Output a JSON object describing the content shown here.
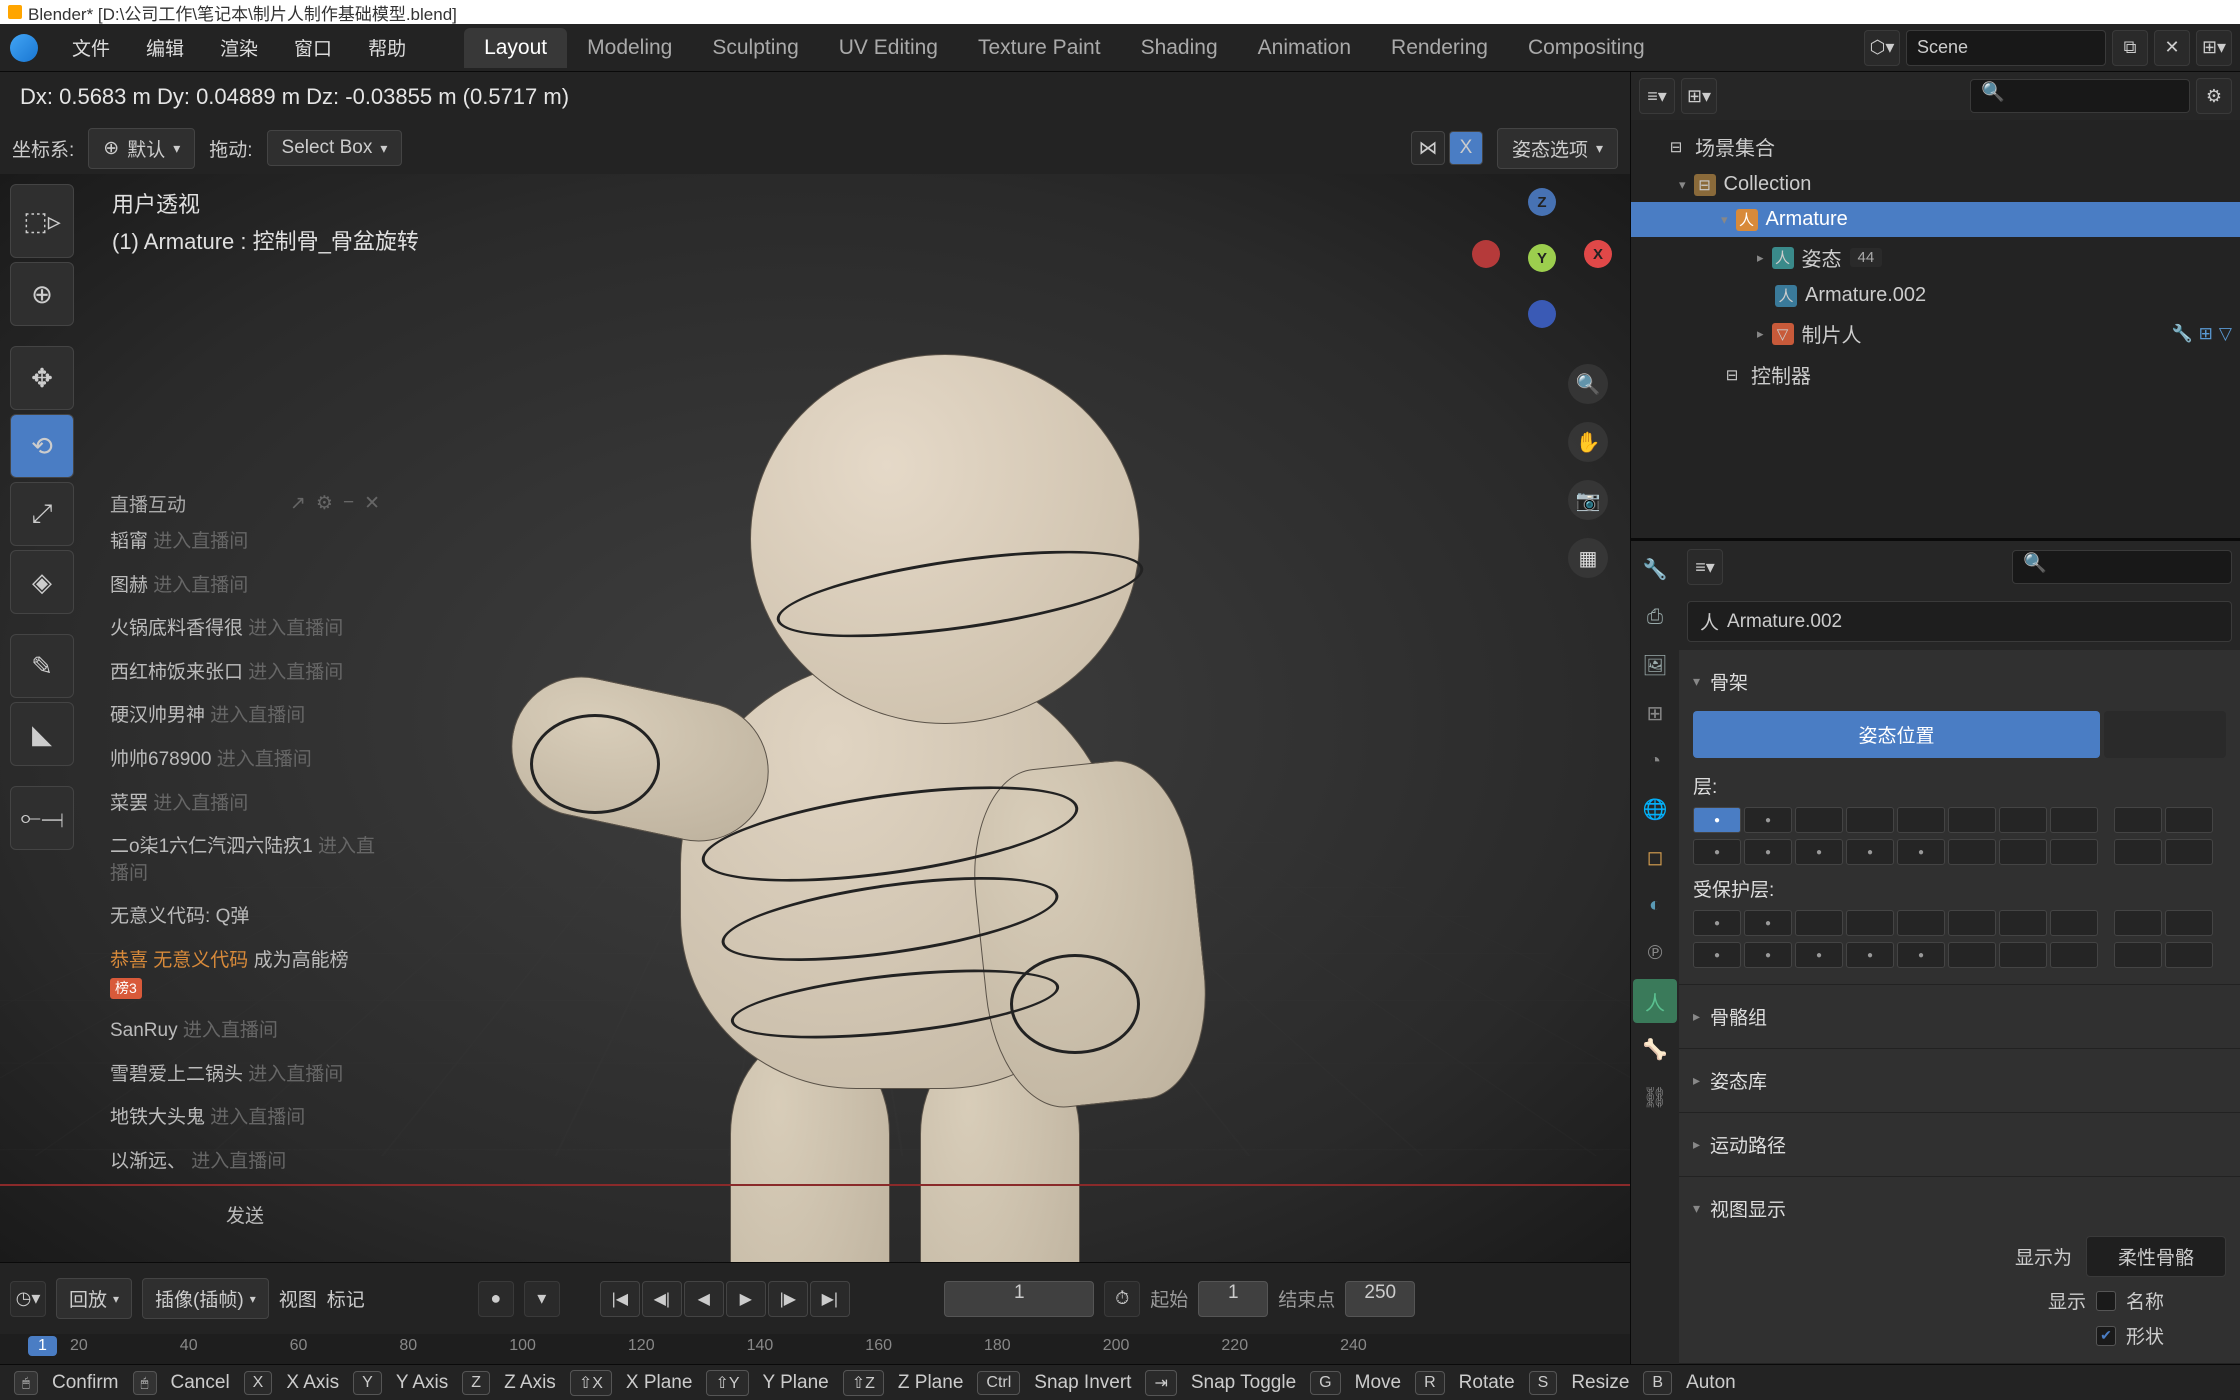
{
  "window_title": "Blender* [D:\\公司工作\\笔记本\\制片人制作基础模型.blend]",
  "menu": {
    "file": "文件",
    "edit": "编辑",
    "render": "渲染",
    "window": "窗口",
    "help": "帮助"
  },
  "workspaces": {
    "layout": "Layout",
    "modeling": "Modeling",
    "sculpting": "Sculpting",
    "uv": "UV Editing",
    "texture": "Texture Paint",
    "shading": "Shading",
    "animation": "Animation",
    "rendering": "Rendering",
    "compositing": "Compositing"
  },
  "topbar": {
    "scene": "Scene"
  },
  "transform_status": "Dx: 0.5683 m   Dy: 0.04889 m   Dz: -0.03855 m (0.5717 m)",
  "viewport_header": {
    "coord_label": "坐标系:",
    "coord_value": "默认",
    "drag_label": "拖动:",
    "select_mode": "Select Box",
    "pose_options": "姿态选项"
  },
  "viewport_overlay": {
    "view": "用户透视",
    "selection": "(1) Armature : 控制骨_骨盆旋转"
  },
  "gizmo": {
    "x": "X",
    "y": "Y",
    "z": "Z"
  },
  "chat": {
    "title": "直播互动",
    "send": "发送",
    "lines": [
      {
        "user": "韬甯",
        "action": "进入直播间"
      },
      {
        "user": "图赫",
        "action": "进入直播间"
      },
      {
        "user": "火锅底料香得很",
        "action": "进入直播间"
      },
      {
        "user": "西红柿饭来张口",
        "action": "进入直播间"
      },
      {
        "user": "硬汉帅男神",
        "action": "进入直播间"
      },
      {
        "user": "帅帅678900",
        "action": "进入直播间"
      },
      {
        "user": "菜罢",
        "action": "进入直播间"
      },
      {
        "user": "二o柒1六仁汽泗六陆疚1",
        "action": "进入直播间"
      },
      {
        "user": "无意义代码:",
        "action": "Q弹"
      },
      {
        "user": "恭喜 无意义代码",
        "action": "成为高能榜",
        "badge": "榜3"
      },
      {
        "user": "SanRuy",
        "action": "进入直播间"
      },
      {
        "user": "雪碧爱上二锅头",
        "action": "进入直播间"
      },
      {
        "user": "地铁大头鬼",
        "action": "进入直播间"
      },
      {
        "user": "以渐远、",
        "action": "进入直播间"
      }
    ]
  },
  "timeline": {
    "playback_label": "回放",
    "keying_label": "插像(插帧)",
    "view_label": "视图",
    "marker_label": "标记",
    "current_frame": "1",
    "start_label": "起始",
    "start_value": "1",
    "end_label": "结束点",
    "end_value": "250",
    "ticks": [
      "20",
      "40",
      "60",
      "80",
      "100",
      "120",
      "140",
      "160",
      "180",
      "200",
      "220",
      "240"
    ],
    "marker": "1"
  },
  "outliner": {
    "scene_collection": "场景集合",
    "collection": "Collection",
    "armature": "Armature",
    "pose": "姿态",
    "pose_count": "44",
    "armature_data": "Armature.002",
    "mesh": "制片人",
    "controller": "控制器"
  },
  "properties": {
    "breadcrumb_icon": "⇖",
    "breadcrumb": "Armature.002",
    "skeleton_section": "骨架",
    "pose_position": "姿态位置",
    "layers_label": "层:",
    "protected_label": "受保护层:",
    "bone_groups": "骨骼组",
    "pose_library": "姿态库",
    "motion_paths": "运动路径",
    "viewport_display": "视图显示",
    "display_as_label": "显示为",
    "display_as_value": "柔性骨骼",
    "show_label": "显示",
    "show_names": "名称",
    "show_shapes": "形状"
  },
  "status_bar": {
    "confirm": "Confirm",
    "cancel": "Cancel",
    "x_axis": "X Axis",
    "y_axis": "Y Axis",
    "z_axis": "Z Axis",
    "x_plane": "X Plane",
    "y_plane": "Y Plane",
    "z_plane": "Z Plane",
    "snap_invert": "Snap Invert",
    "snap_toggle": "Snap Toggle",
    "move": "Move",
    "rotate": "Rotate",
    "resize": "Resize",
    "auto": "Auton",
    "keys": {
      "x": "X",
      "y": "Y",
      "z": "Z",
      "sx": "⇧X",
      "sy": "⇧Y",
      "sz": "⇧Z",
      "ctrl": "Ctrl",
      "tab": "⇥",
      "g": "G",
      "r": "R",
      "s": "S",
      "b": "B"
    }
  }
}
